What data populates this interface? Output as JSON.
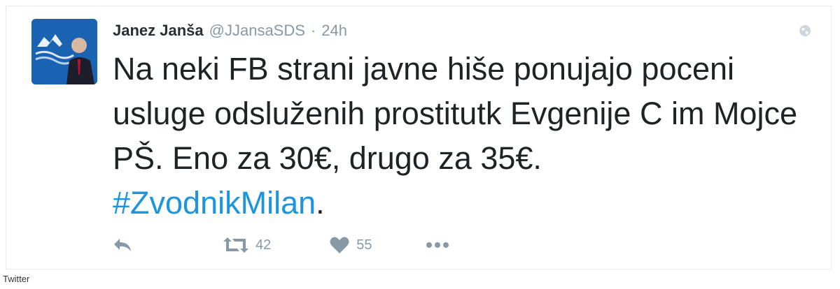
{
  "tweet": {
    "author_name": "Janez Janša",
    "handle": "@JJansaSDS",
    "separator": "·",
    "time": "24h",
    "text_main": "Na neki FB strani javne hiše ponujajo poceni usluge odsluženih prostitutk Evgenije C im Mojce PŠ. Eno za 30€, drugo za 35€.",
    "hashtag": "#ZvodnikMilan",
    "text_end": "."
  },
  "actions": {
    "reply_icon": "reply-icon",
    "retweet_icon": "retweet-icon",
    "retweet_count": "42",
    "like_icon": "heart-icon",
    "like_count": "55",
    "more_icon": "more-dots-icon"
  },
  "caption": "Twitter",
  "colors": {
    "name": "#292f33",
    "muted": "#8899a6",
    "body_text": "#1f2326",
    "hashtag": "#1b95e0",
    "avatar_bg": "#1a63b3"
  }
}
